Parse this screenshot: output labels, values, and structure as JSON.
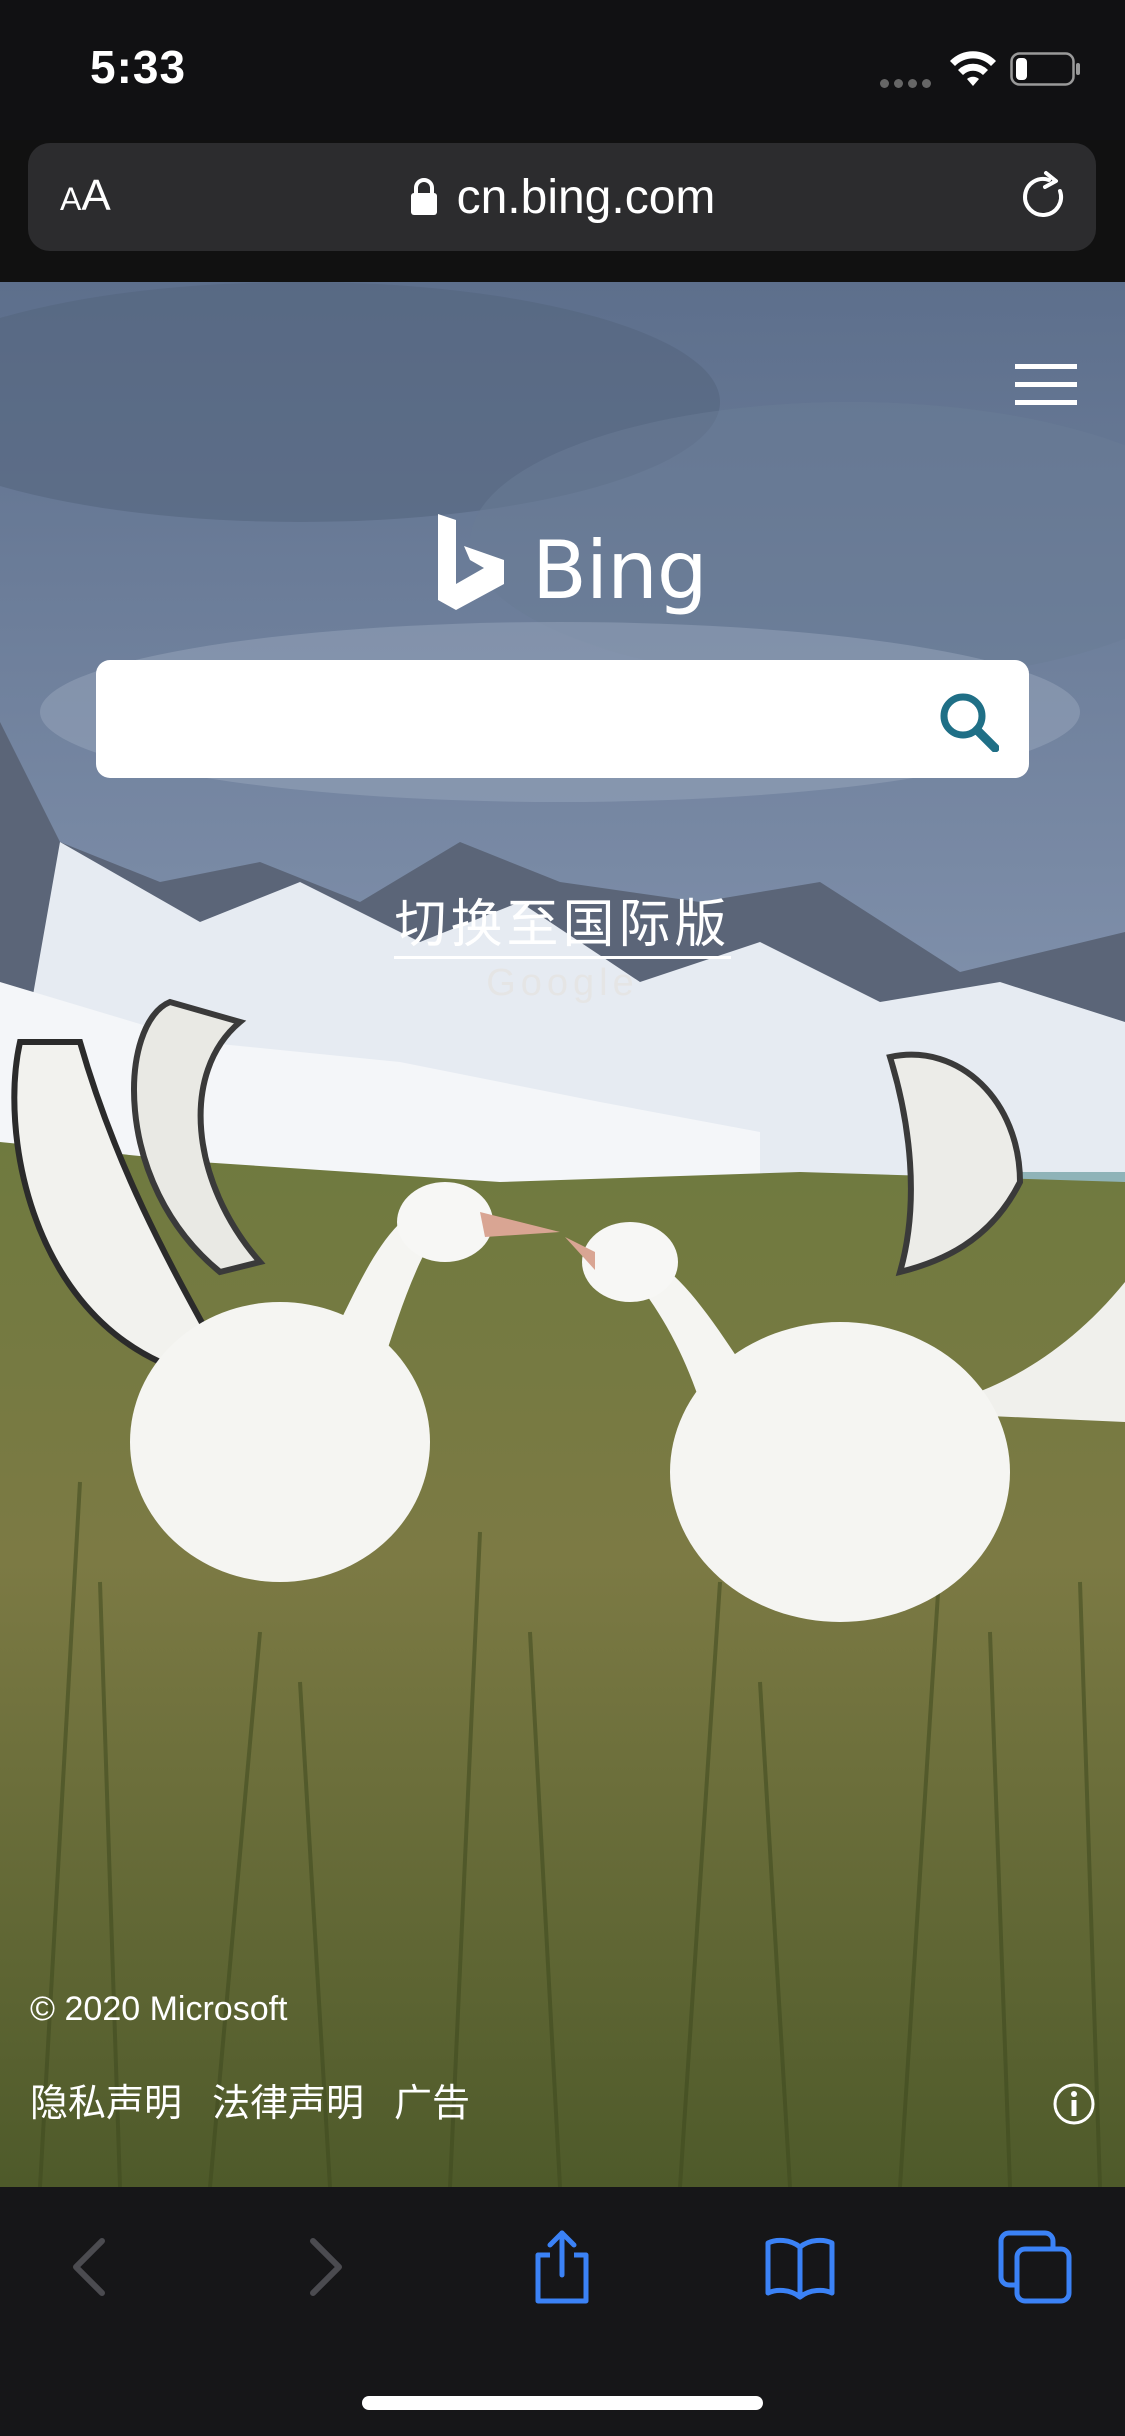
{
  "status_bar": {
    "time": "5:33",
    "icons": [
      "cellular-icon",
      "wifi-icon",
      "battery-icon"
    ],
    "battery_level": 0.18
  },
  "address_bar": {
    "aa_small": "A",
    "aa_large": "A",
    "url": "cn.bing.com",
    "icons": [
      "lock-icon",
      "reload-icon"
    ]
  },
  "page": {
    "logo_text": "Bing",
    "search": {
      "value": "",
      "placeholder": ""
    },
    "switch_link": "切换至国际版",
    "google_link": "Google",
    "copyright": "© 2020 Microsoft",
    "footer_links": [
      "隐私声明",
      "法律声明",
      "广告"
    ],
    "icons": [
      "menu-icon",
      "bing-logo-icon",
      "search-icon",
      "info-icon"
    ]
  },
  "toolbar": {
    "buttons": [
      "back-button",
      "forward-button",
      "share-button",
      "bookmarks-button",
      "tabs-button"
    ],
    "accent_color": "#3b82f6",
    "disabled_color": "#4b4b50"
  }
}
